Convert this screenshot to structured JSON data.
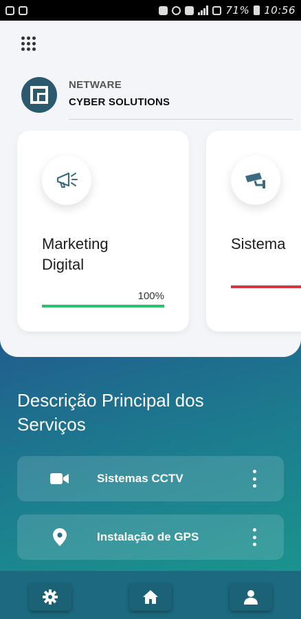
{
  "status_bar": {
    "battery_percent": "71%",
    "time": "10:56"
  },
  "header": {
    "menu_icon": "apps-grid-icon",
    "brand_line1": "NETWARE",
    "brand_line2": "CYBER SOLUTIONS"
  },
  "cards": [
    {
      "title": "Marketing Digital",
      "icon": "megaphone-icon",
      "progress_label": "100%",
      "progress": 1.0,
      "bar_color": "#27c46a"
    },
    {
      "title": "Sistema",
      "icon": "cctv-camera-icon",
      "progress": 1.0,
      "bar_color": "#d8343f"
    }
  ],
  "section": {
    "title": "Descrição Principal dos Serviços"
  },
  "services": [
    {
      "label": "Sistemas CCTV",
      "icon": "video-camera-icon"
    },
    {
      "label": "Instalação de GPS",
      "icon": "location-pin-icon"
    }
  ],
  "bottom_nav": [
    {
      "icon": "settings-gear-icon"
    },
    {
      "icon": "home-icon"
    },
    {
      "icon": "user-icon"
    }
  ],
  "colors": {
    "logo_bg": "#2b5a6e",
    "nav_bg": "#1c6a80",
    "progress_green": "#27c46a",
    "progress_red": "#d8343f"
  }
}
